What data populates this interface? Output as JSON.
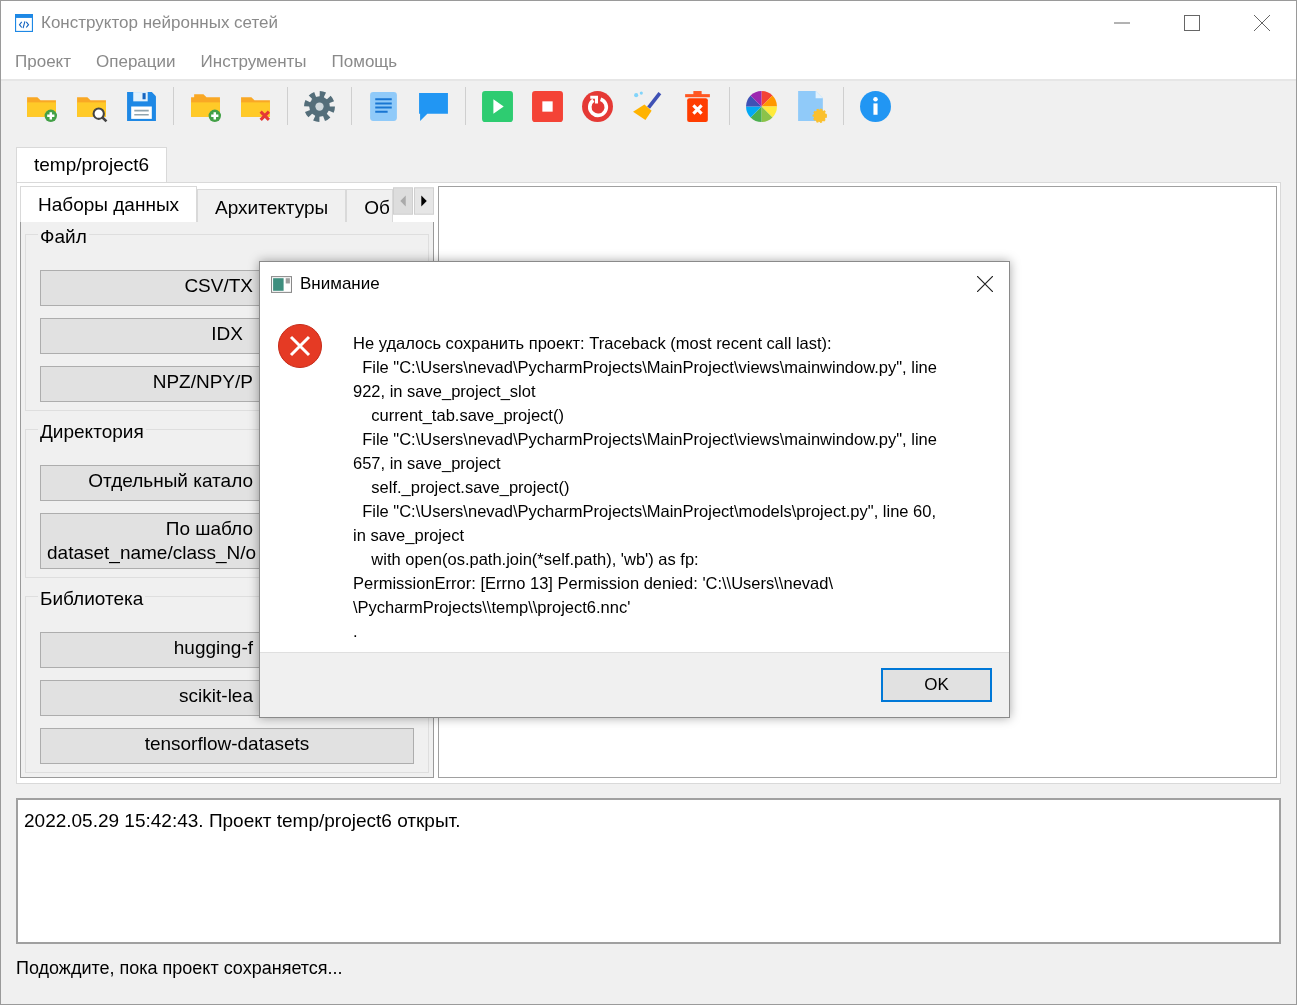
{
  "window": {
    "title": "Конструктор нейронных сетей"
  },
  "menu": [
    "Проект",
    "Операции",
    "Инструменты",
    "Помощь"
  ],
  "project_tabs": [
    {
      "label": "temp/project6",
      "selected": true
    }
  ],
  "panel_tabs": [
    {
      "label": "Наборы данных",
      "selected": true
    },
    {
      "label": "Архитектуры",
      "selected": false
    },
    {
      "label": "Об",
      "selected": false
    }
  ],
  "groups": [
    {
      "title": "Файл",
      "buttons": [
        {
          "label": "CSV/TX",
          "clipped": true
        },
        {
          "label": "IDX",
          "clipped": false
        },
        {
          "label": "NPZ/NPY/P",
          "clipped": true
        }
      ]
    },
    {
      "title": "Директория",
      "buttons": [
        {
          "label": "Отдельный катало",
          "clipped": true
        },
        {
          "label": "По шабло\ndataset_name/class_N/o",
          "clipped": true
        }
      ]
    },
    {
      "title": "Библиотека",
      "buttons": [
        {
          "label": "hugging-f",
          "clipped": true
        },
        {
          "label": "scikit-lea",
          "clipped": true
        },
        {
          "label": "tensorflow-datasets",
          "clipped": false
        }
      ]
    }
  ],
  "log": [
    "2022.05.29 15:42:43. Проект temp/project6 открыт."
  ],
  "status_bar": "Подождите, пока проект сохраняется...",
  "dialog": {
    "title": "Внимание",
    "message": "Не удалось сохранить проект: Traceback (most recent call last):\n  File \"C:\\Users\\nevad\\PycharmProjects\\MainProject\\views\\mainwindow.py\", line\n922, in save_project_slot\n    current_tab.save_project()\n  File \"C:\\Users\\nevad\\PycharmProjects\\MainProject\\views\\mainwindow.py\", line\n657, in save_project\n    self._project.save_project()\n  File \"C:\\Users\\nevad\\PycharmProjects\\MainProject\\models\\project.py\", line 60,\nin save_project\n    with open(os.path.join(*self.path), 'wb') as fp:\nPermissionError: [Errno 13] Permission denied: 'C:\\\\Users\\\\nevad\\\n\\PycharmProjects\\\\temp\\\\project6.nnc'\n.",
    "buttons": [
      {
        "label": "OK",
        "default": true
      }
    ]
  }
}
